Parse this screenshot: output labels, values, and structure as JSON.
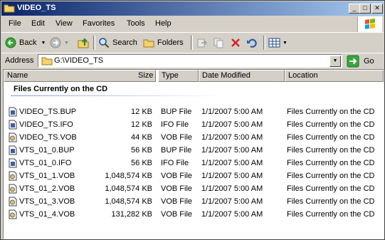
{
  "window": {
    "title": "VIDEO_TS"
  },
  "title_buttons": {
    "minimize": "_",
    "maximize": "□",
    "close": "✕"
  },
  "menu": [
    "File",
    "Edit",
    "View",
    "Favorites",
    "Tools",
    "Help"
  ],
  "toolbar": {
    "back_label": "Back",
    "search_label": "Search",
    "folders_label": "Folders"
  },
  "address": {
    "label": "Address",
    "value": "G:\\VIDEO_TS",
    "go_label": "Go"
  },
  "columns": [
    "Name",
    "Size",
    "Type",
    "Date Modified",
    "Location"
  ],
  "group_header": "Files Currently on the CD",
  "files": [
    {
      "name": "VIDEO_TS.BUP",
      "size": "12 KB",
      "type": "BUP File",
      "date": "1/1/2007 5:00 AM",
      "location": "Files Currently on the CD",
      "icon": "ifo-file-icon"
    },
    {
      "name": "VIDEO_TS.IFO",
      "size": "12 KB",
      "type": "IFO File",
      "date": "1/1/2007 5:00 AM",
      "location": "Files Currently on the CD",
      "icon": "ifo-file-icon"
    },
    {
      "name": "VIDEO_TS.VOB",
      "size": "44 KB",
      "type": "VOB File",
      "date": "1/1/2007 5:00 AM",
      "location": "Files Currently on the CD",
      "icon": "vob-file-icon"
    },
    {
      "name": "VTS_01_0.BUP",
      "size": "56 KB",
      "type": "BUP File",
      "date": "1/1/2007 5:00 AM",
      "location": "Files Currently on the CD",
      "icon": "ifo-file-icon"
    },
    {
      "name": "VTS_01_0.IFO",
      "size": "56 KB",
      "type": "IFO File",
      "date": "1/1/2007 5:00 AM",
      "location": "Files Currently on the CD",
      "icon": "ifo-file-icon"
    },
    {
      "name": "VTS_01_1.VOB",
      "size": "1,048,574 KB",
      "type": "VOB File",
      "date": "1/1/2007 5:00 AM",
      "location": "Files Currently on the CD",
      "icon": "vob-file-icon"
    },
    {
      "name": "VTS_01_2.VOB",
      "size": "1,048,574 KB",
      "type": "VOB File",
      "date": "1/1/2007 5:00 AM",
      "location": "Files Currently on the CD",
      "icon": "vob-file-icon"
    },
    {
      "name": "VTS_01_3.VOB",
      "size": "1,048,574 KB",
      "type": "VOB File",
      "date": "1/1/2007 5:00 AM",
      "location": "Files Currently on the CD",
      "icon": "vob-file-icon"
    },
    {
      "name": "VTS_01_4.VOB",
      "size": "131,282 KB",
      "type": "VOB File",
      "date": "1/1/2007 5:00 AM",
      "location": "Files Currently on the CD",
      "icon": "vob-file-icon"
    }
  ],
  "colors": {
    "titlebar_start": "#0a246a",
    "titlebar_end": "#a6caf0",
    "chrome": "#d4d0c8"
  }
}
